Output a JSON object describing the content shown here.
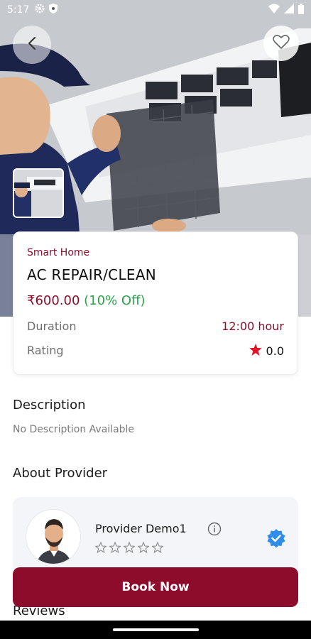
{
  "status_bar": {
    "time": "5:17"
  },
  "service": {
    "category": "Smart Home",
    "name": "AC REPAIR/CLEAN",
    "price": "₹600.00",
    "discount": "(10% Off)",
    "duration_label": "Duration",
    "duration_value": "12:00 hour",
    "rating_label": "Rating",
    "rating_value": "0.0"
  },
  "description": {
    "title": "Description",
    "text": "No Description Available"
  },
  "provider": {
    "section_title": "About Provider",
    "name": "Provider Demo1",
    "rating_stars": 0,
    "max_stars": 5
  },
  "reviews": {
    "title": "Reviews"
  },
  "actions": {
    "book_label": "Book Now"
  },
  "colors": {
    "accent": "#8d0c2b",
    "discount": "#2aa44a",
    "verified": "#2f8ce8",
    "star": "#e0152b"
  },
  "icons": [
    "back-arrow-icon",
    "heart-icon",
    "settings-gear-icon",
    "shield-icon",
    "wifi-icon",
    "signal-icon",
    "battery-icon",
    "star-icon",
    "info-icon",
    "verified-badge-icon"
  ]
}
